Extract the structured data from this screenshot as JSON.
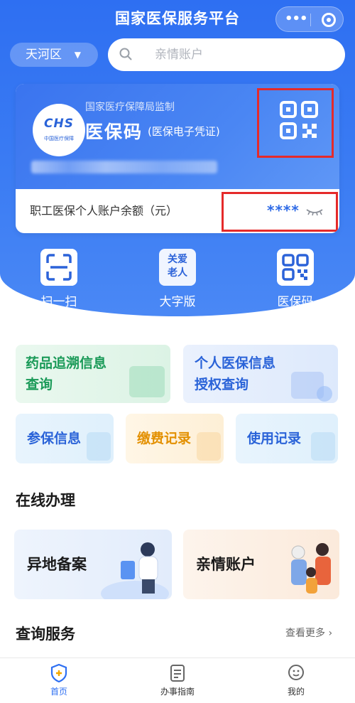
{
  "colors": {
    "primary": "#2e6ff2",
    "highlight_box": "#e52a2a",
    "green": "#1a9a58",
    "blue": "#2a63d8",
    "orange": "#e39000",
    "text_dark": "#1a1a1a"
  },
  "header": {
    "title": "国家医保服务平台",
    "more_icon": "more-dots-icon",
    "close_icon": "target-icon"
  },
  "region": {
    "label": "天河区",
    "caret": "▼"
  },
  "search": {
    "placeholder": "亲情账户"
  },
  "card": {
    "logo_text": "CHS",
    "logo_subtext": "中国医疗保障",
    "supervise": "国家医疗保障局监制",
    "title": "医保码",
    "subtitle": "(医保电子凭证)",
    "qr_icon": "qr-code-icon",
    "balance_label": "职工医保个人账户余额（元）",
    "balance_masked": "****",
    "eye_icon": "eye-closed-icon"
  },
  "quick_actions": [
    {
      "label": "扫一扫",
      "icon": "scan-icon"
    },
    {
      "label": "大字版",
      "icon": "care-elderly-icon",
      "icon_text": "关爱\n老人"
    },
    {
      "label": "医保码",
      "icon": "qr-code-icon"
    }
  ],
  "tiles": {
    "drug_trace": "药品追溯信息\n查询",
    "personal_auth": "个人医保信息\n授权查询",
    "insured_info": "参保信息",
    "payment_record": "缴费记录",
    "usage_record": "使用记录"
  },
  "online": {
    "title": "在线办理",
    "cards": [
      {
        "label": "异地备案"
      },
      {
        "label": "亲情账户"
      }
    ]
  },
  "query": {
    "title": "查询服务",
    "more": "查看更多 ›"
  },
  "tabbar": [
    {
      "label": "首页",
      "icon": "home-shield-icon",
      "active": true
    },
    {
      "label": "办事指南",
      "icon": "guide-doc-icon",
      "active": false
    },
    {
      "label": "我的",
      "icon": "profile-icon",
      "active": false
    }
  ]
}
